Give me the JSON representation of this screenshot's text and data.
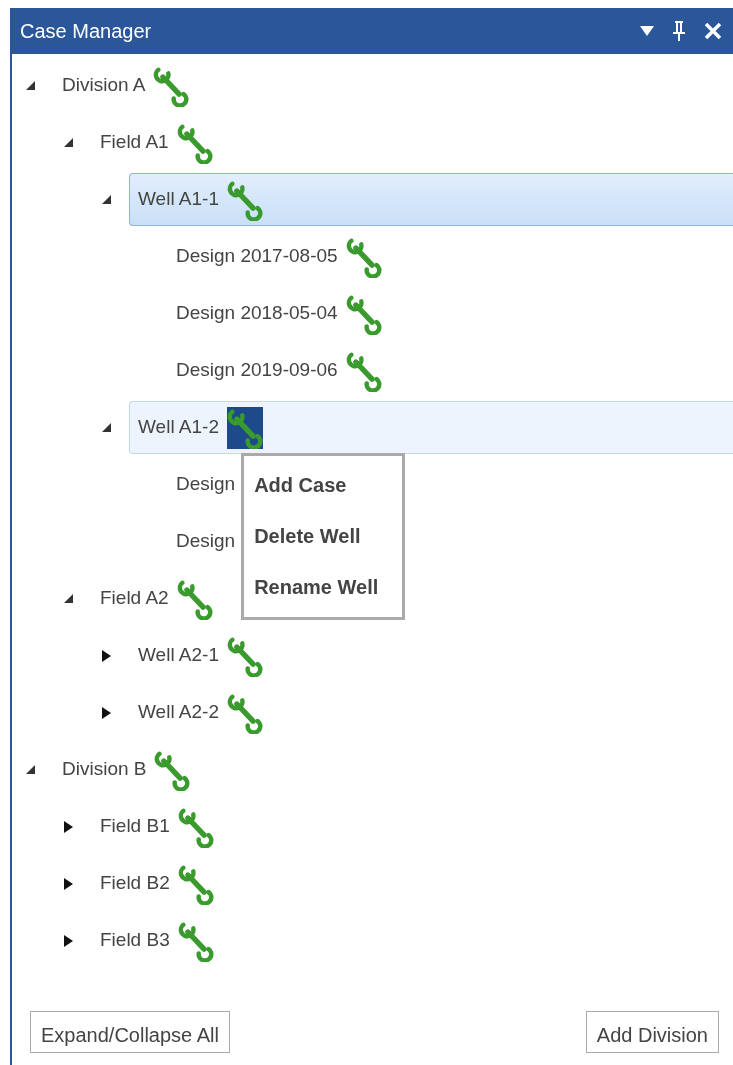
{
  "window": {
    "title": "Case Manager"
  },
  "tree": [
    {
      "label": "Division A",
      "expanded": true,
      "selected": false,
      "hovered": false,
      "children": [
        {
          "label": "Field A1",
          "expanded": true,
          "selected": false,
          "hovered": false,
          "children": [
            {
              "label": "Well A1-1",
              "expanded": true,
              "selected": true,
              "hovered": false,
              "children": [
                {
                  "label": "Design 2017-08-05",
                  "selected": false,
                  "hovered": false
                },
                {
                  "label": "Design 2018-05-04",
                  "selected": false,
                  "hovered": false
                },
                {
                  "label": "Design 2019-09-06",
                  "selected": false,
                  "hovered": false
                }
              ]
            },
            {
              "label": "Well A1-2",
              "expanded": true,
              "selected": false,
              "hovered": true,
              "context_menu": {
                "items": [
                  "Add Case",
                  "Delete Well",
                  "Rename Well"
                ]
              },
              "children": [
                {
                  "label": "Design",
                  "selected": false,
                  "hovered": false
                },
                {
                  "label": "Design",
                  "selected": false,
                  "hovered": false
                }
              ]
            }
          ]
        },
        {
          "label": "Field A2",
          "expanded": true,
          "selected": false,
          "hovered": false,
          "children": [
            {
              "label": "Well A2-1",
              "expanded": false,
              "selected": false,
              "hovered": false
            },
            {
              "label": "Well A2-2",
              "expanded": false,
              "selected": false,
              "hovered": false
            }
          ]
        }
      ]
    },
    {
      "label": "Division B",
      "expanded": true,
      "selected": false,
      "hovered": false,
      "children": [
        {
          "label": "Field B1",
          "expanded": false,
          "selected": false,
          "hovered": false
        },
        {
          "label": "Field B2",
          "expanded": false,
          "selected": false,
          "hovered": false
        },
        {
          "label": "Field B3",
          "expanded": false,
          "selected": false,
          "hovered": false
        }
      ]
    }
  ],
  "buttons": [
    "Expand/Collapse All",
    "Add Division"
  ]
}
